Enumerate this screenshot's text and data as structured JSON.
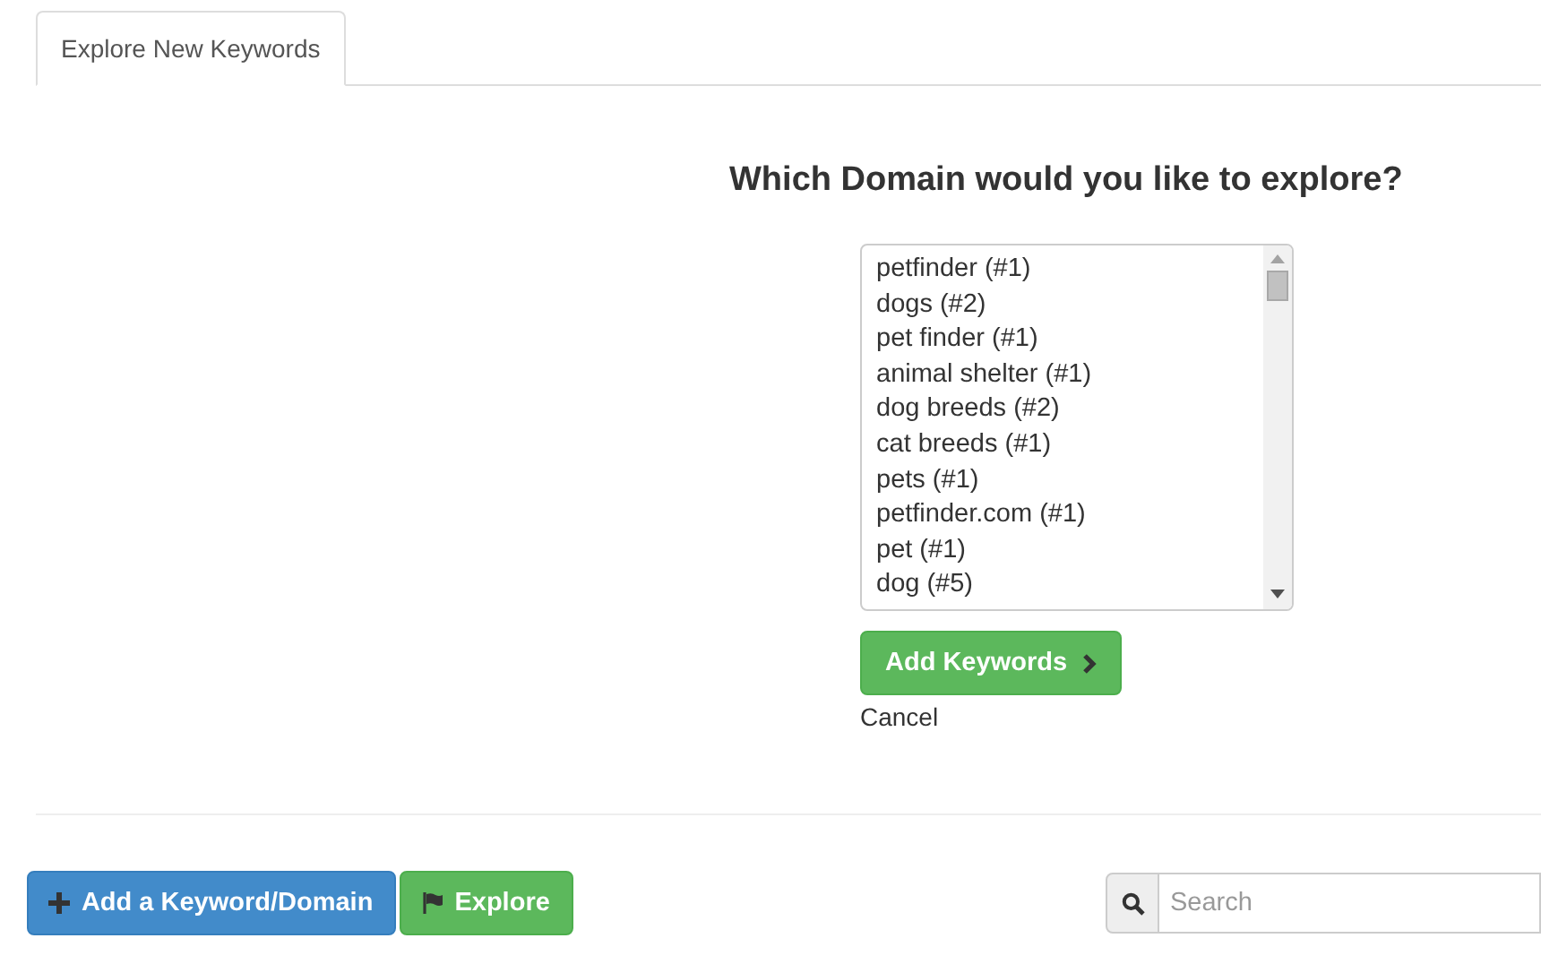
{
  "tabs": [
    {
      "label": "Explore New Keywords",
      "selected": true
    }
  ],
  "heading": "Which Domain would you like to explore?",
  "domains": [
    {
      "label": "petfinder (#1)",
      "selected": false
    },
    {
      "label": "dogs (#2)",
      "selected": false
    },
    {
      "label": "pet finder (#1)",
      "selected": false
    },
    {
      "label": "animal shelter (#1)",
      "selected": false
    },
    {
      "label": "dog breeds (#2)",
      "selected": false
    },
    {
      "label": "cat breeds (#1)",
      "selected": false
    },
    {
      "label": "pets (#1)",
      "selected": false
    },
    {
      "label": "petfinder.com (#1)",
      "selected": false
    },
    {
      "label": "pet (#1)",
      "selected": false
    },
    {
      "label": "dog (#5)",
      "selected": false
    }
  ],
  "add_keywords_button": "Add Keywords",
  "cancel_link": "Cancel",
  "add_button": "Add a Keyword/Domain",
  "explore_button": "Explore",
  "search": {
    "placeholder": "Search"
  }
}
